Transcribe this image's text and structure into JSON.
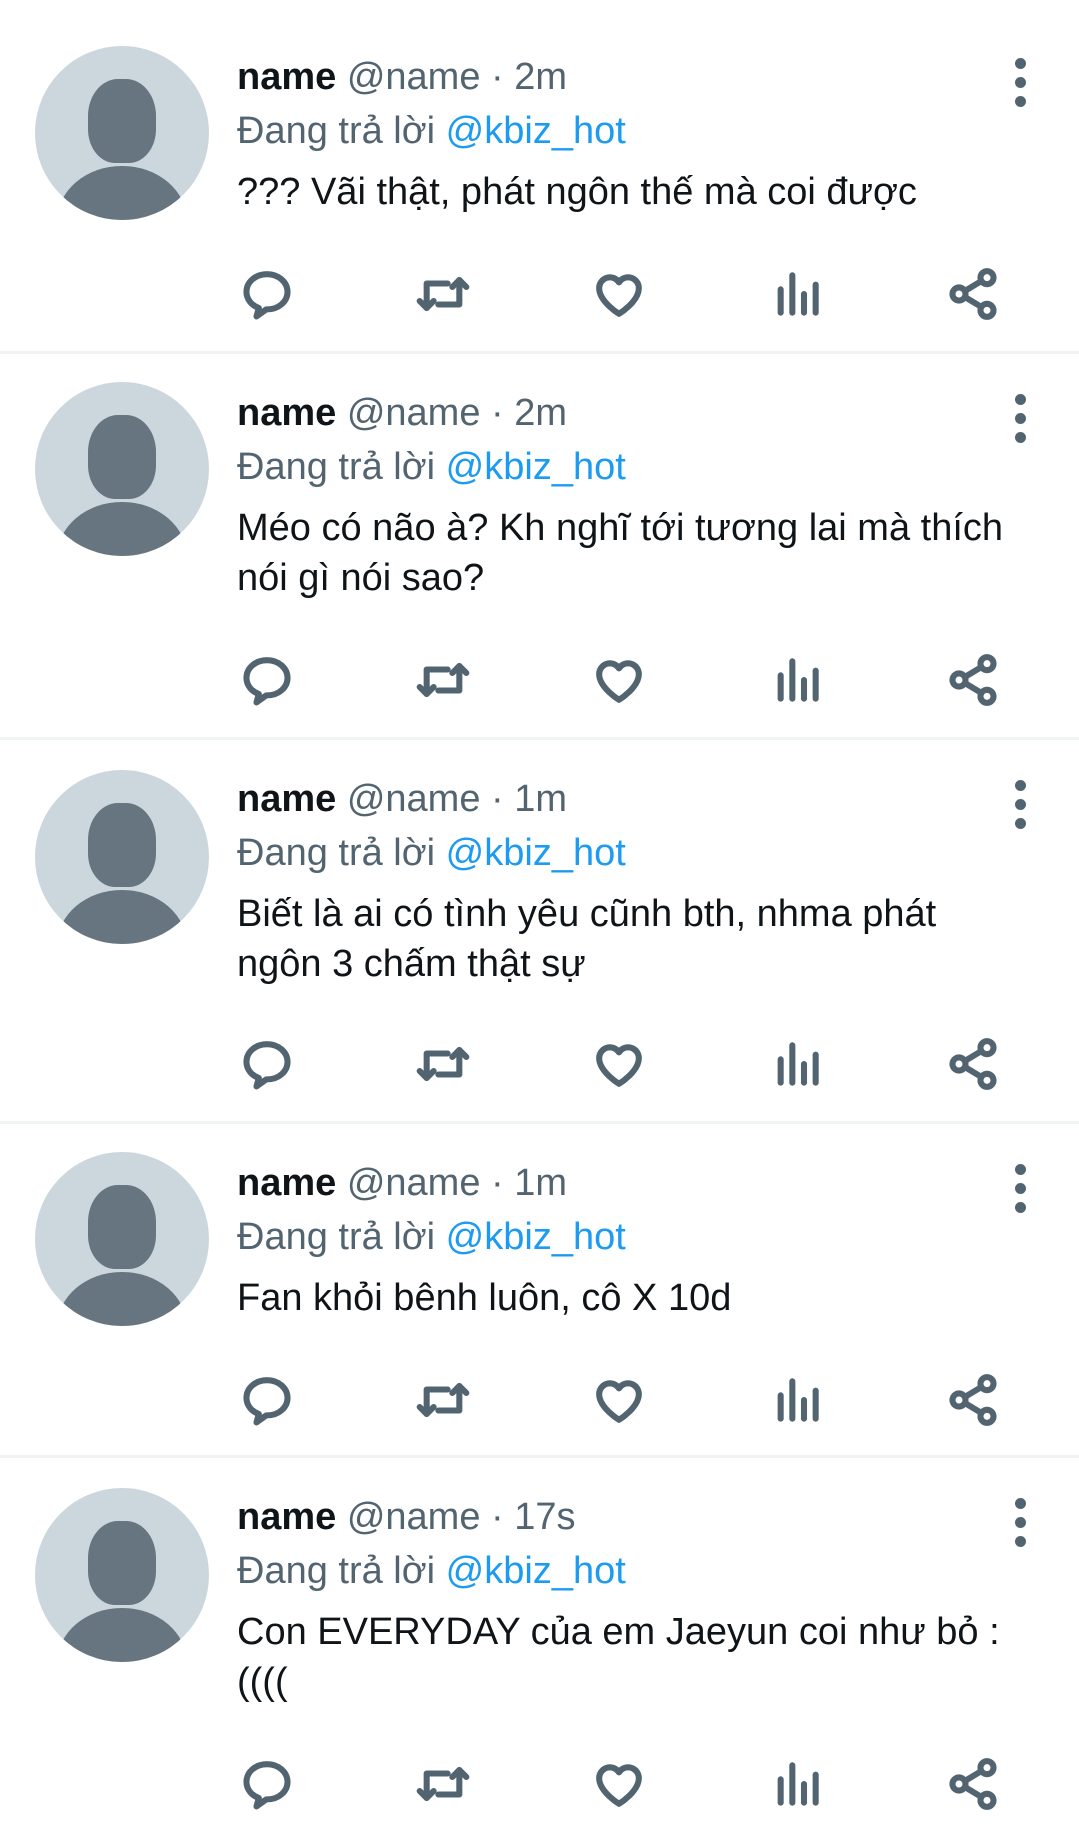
{
  "tweets": [
    {
      "name": "name",
      "handle": "@name",
      "separator": "·",
      "time": "2m",
      "reply_prefix": "Đang trả lời",
      "reply_to": "@kbiz_hot",
      "text": "??? Vãi thật, phát ngôn thế mà coi được"
    },
    {
      "name": "name",
      "handle": "@name",
      "separator": "·",
      "time": "2m",
      "reply_prefix": "Đang trả lời",
      "reply_to": "@kbiz_hot",
      "text": "Méo có não à? Kh nghĩ tới tương lai mà thích nói gì nói sao?"
    },
    {
      "name": "name",
      "handle": "@name",
      "separator": "·",
      "time": "1m",
      "reply_prefix": "Đang trả lời",
      "reply_to": "@kbiz_hot",
      "text": "Biết là ai có tình yêu cũnh bth, nhma phát ngôn 3 chấm thật sự"
    },
    {
      "name": "name",
      "handle": "@name",
      "separator": "·",
      "time": "1m",
      "reply_prefix": "Đang trả lời",
      "reply_to": "@kbiz_hot",
      "text": "Fan khỏi bênh luôn, cô X 10d"
    },
    {
      "name": "name",
      "handle": "@name",
      "separator": "·",
      "time": "17s",
      "reply_prefix": "Đang trả lời",
      "reply_to": "@kbiz_hot",
      "text": "Con EVERYDAY của em Jaeyun coi như bỏ :(((("
    }
  ],
  "icons": {
    "reply": "reply-icon",
    "retweet": "retweet-icon",
    "like": "heart-icon",
    "views": "views-icon",
    "share": "share-icon",
    "more": "more-vertical-icon",
    "avatar": "default-avatar-icon"
  },
  "colors": {
    "mention": "#1d9bf0",
    "secondary_text": "#536471",
    "primary_text": "#0f1419",
    "avatar_bg": "#ccd6dd",
    "avatar_fg": "#66757f",
    "divider": "#eff3f4"
  }
}
